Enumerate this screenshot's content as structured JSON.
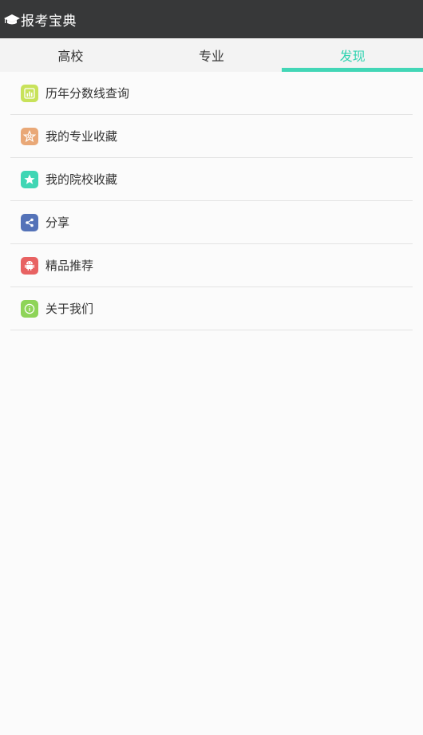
{
  "app": {
    "title": "报考宝典",
    "icon": "graduation-cap-icon"
  },
  "tabs": [
    {
      "label": "高校",
      "active": false
    },
    {
      "label": "专业",
      "active": false
    },
    {
      "label": "发现",
      "active": true
    }
  ],
  "colors": {
    "accent": "#42d6b6",
    "titlebar": "#373839"
  },
  "menu": [
    {
      "label": "历年分数线查询",
      "icon": "bar-chart-icon",
      "color": "#c8e25a"
    },
    {
      "label": "我的专业收藏",
      "icon": "star-outline-icon",
      "color": "#e9a877"
    },
    {
      "label": "我的院校收藏",
      "icon": "star-icon",
      "color": "#3fd6b4"
    },
    {
      "label": "分享",
      "icon": "share-icon",
      "color": "#5472b8"
    },
    {
      "label": "精品推荐",
      "icon": "android-icon",
      "color": "#e86262"
    },
    {
      "label": "关于我们",
      "icon": "info-icon",
      "color": "#8ed458"
    }
  ]
}
